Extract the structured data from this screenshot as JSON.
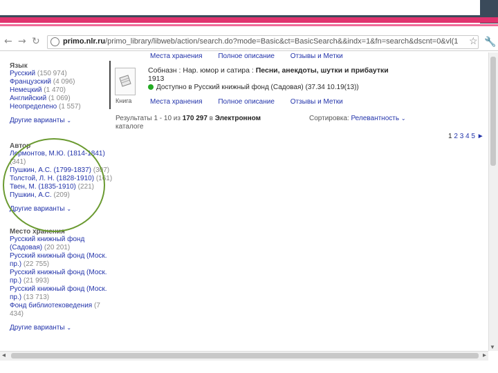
{
  "browser": {
    "back_icon": "arrow-left",
    "forward_icon": "arrow-right",
    "reload_icon": "reload",
    "url_host": "primo.nlr.ru",
    "url_path": "/primo_library/libweb/action/search.do?mode=Basic&ct=BasicSearch&&indx=1&fn=search&dscnt=0&vl(1"
  },
  "facets": {
    "language": {
      "title": "Язык",
      "items": [
        {
          "label": "Русский",
          "count": "(150 974)"
        },
        {
          "label": "Французский",
          "count": "(4 096)"
        },
        {
          "label": "Немецкий",
          "count": "(1 470)"
        },
        {
          "label": "Английский",
          "count": "(1 069)"
        },
        {
          "label": "Неопределено",
          "count": "(1 557)"
        }
      ],
      "more": "Другие варианты"
    },
    "author": {
      "title": "Автор",
      "items": [
        {
          "label": "Лермонтов, М.Ю. (1814-1841)",
          "count": "(341)"
        },
        {
          "label": "Пушкин, А.С. (1799-1837)",
          "count": "(307)"
        },
        {
          "label": "Толстой, Л. Н. (1828-1910)",
          "count": "(161)"
        },
        {
          "label": "Твен, М. (1835-1910)",
          "count": "(221)"
        },
        {
          "label": "Пушкин, А.С.",
          "count": "(209)"
        }
      ],
      "more": "Другие варианты"
    },
    "location": {
      "title": "Место хранения",
      "items": [
        {
          "label": "Русский книжный фонд (Садовая)",
          "count": "(20 201)"
        },
        {
          "label": "Русский книжный фонд (Моск. пр.)",
          "count": "(22 755)"
        },
        {
          "label": "Русский книжный фонд (Моск. пр.)",
          "count": "(21 993)"
        },
        {
          "label": "Русский книжный фонд (Моск. пр.)",
          "count": "(13 713)"
        },
        {
          "label": "Фонд библиотековедения",
          "count": "(7 434)"
        }
      ],
      "more": "Другие варианты"
    }
  },
  "top_links": [
    "Места хранения",
    "Полное описание",
    "Отзывы и Метки"
  ],
  "result": {
    "type_label": "Книга",
    "title_plain": "Собназн : Нар. юмор и сатира : ",
    "title_bold": "Песни, анекдоты, шутки и прибаутки",
    "year": "1913",
    "availability": "Доступно в Русский книжный фонд (Садовая)",
    "shelf": "(37.34 10.19(13))",
    "links": [
      "Места хранения",
      "Полное описание",
      "Отзывы и Метки"
    ]
  },
  "summary": {
    "prefix": "Результаты 1 - 10 из ",
    "total": "170 297",
    "middle": " в ",
    "scope": "Электронном",
    "suffix": "каталоге"
  },
  "sort": {
    "label": "Сортировка:",
    "value": "Релевантность"
  },
  "pager": {
    "current": "1",
    "pages": [
      "2",
      "3",
      "4",
      "5"
    ],
    "next": "►"
  },
  "colors": {
    "pink": "#e0336e",
    "dark": "#3a4a5a",
    "link": "#2233aa",
    "annotation": "#6a9a30"
  }
}
